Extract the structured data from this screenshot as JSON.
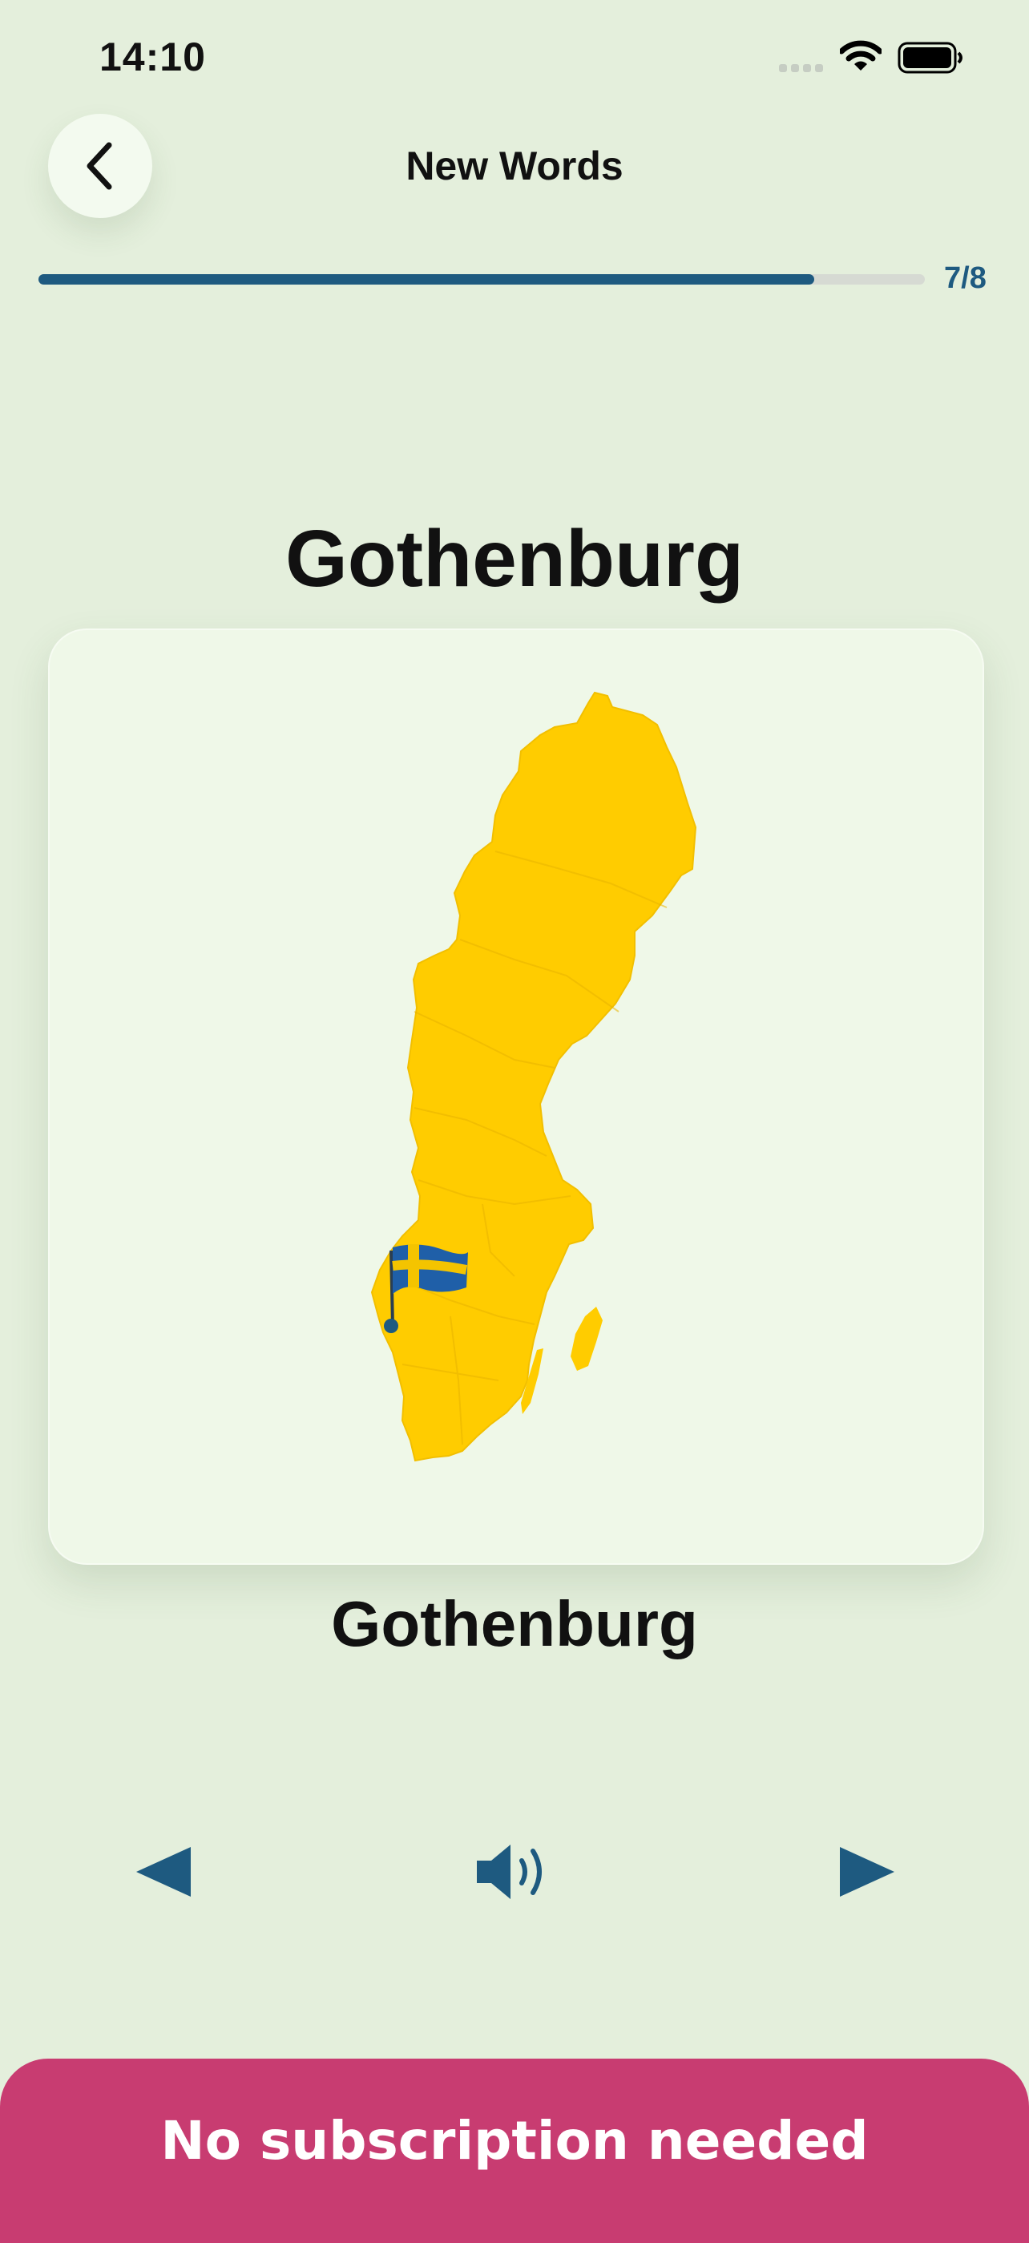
{
  "status_bar": {
    "time": "14:10",
    "icons": [
      "signal-icon",
      "wifi-icon",
      "battery-icon"
    ]
  },
  "header": {
    "title": "New Words",
    "back_icon": "chevron-left-icon"
  },
  "progress": {
    "current": 7,
    "total": 8,
    "label": "7/8",
    "fraction": 0.875
  },
  "card": {
    "word": "Gothenburg",
    "caption": "Gothenburg",
    "map_color": "#ffcc00",
    "flag": "sweden-flag-icon",
    "marker_color": "#1e5a80"
  },
  "controls": {
    "previous_icon": "triangle-left-icon",
    "audio_icon": "speaker-icon",
    "next_icon": "triangle-right-icon"
  },
  "cta": {
    "label": "No subscription needed"
  },
  "colors": {
    "background": "#e4efdc",
    "accent": "#1e5a80",
    "cta": "#c83c71"
  }
}
